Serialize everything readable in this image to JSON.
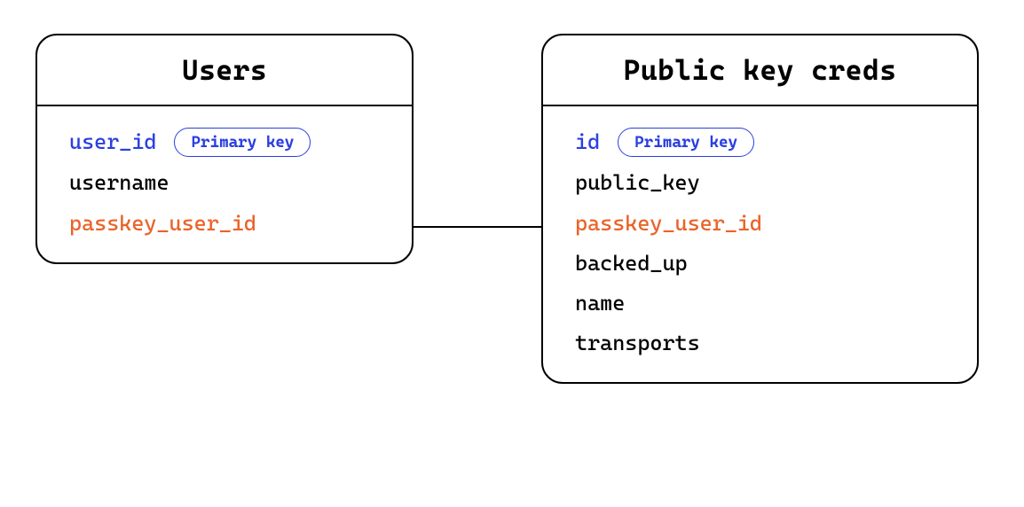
{
  "entities": {
    "users": {
      "title": "Users",
      "fields": [
        {
          "name": "user_id",
          "kind": "pk",
          "badge": "Primary key"
        },
        {
          "name": "username",
          "kind": "normal"
        },
        {
          "name": "passkey_user_id",
          "kind": "fk"
        }
      ]
    },
    "creds": {
      "title": "Public key creds",
      "fields": [
        {
          "name": "id",
          "kind": "pk",
          "badge": "Primary key"
        },
        {
          "name": "public_key",
          "kind": "normal"
        },
        {
          "name": "passkey_user_id",
          "kind": "fk"
        },
        {
          "name": "backed_up",
          "kind": "normal"
        },
        {
          "name": "name",
          "kind": "normal"
        },
        {
          "name": "transports",
          "kind": "normal"
        }
      ]
    }
  }
}
